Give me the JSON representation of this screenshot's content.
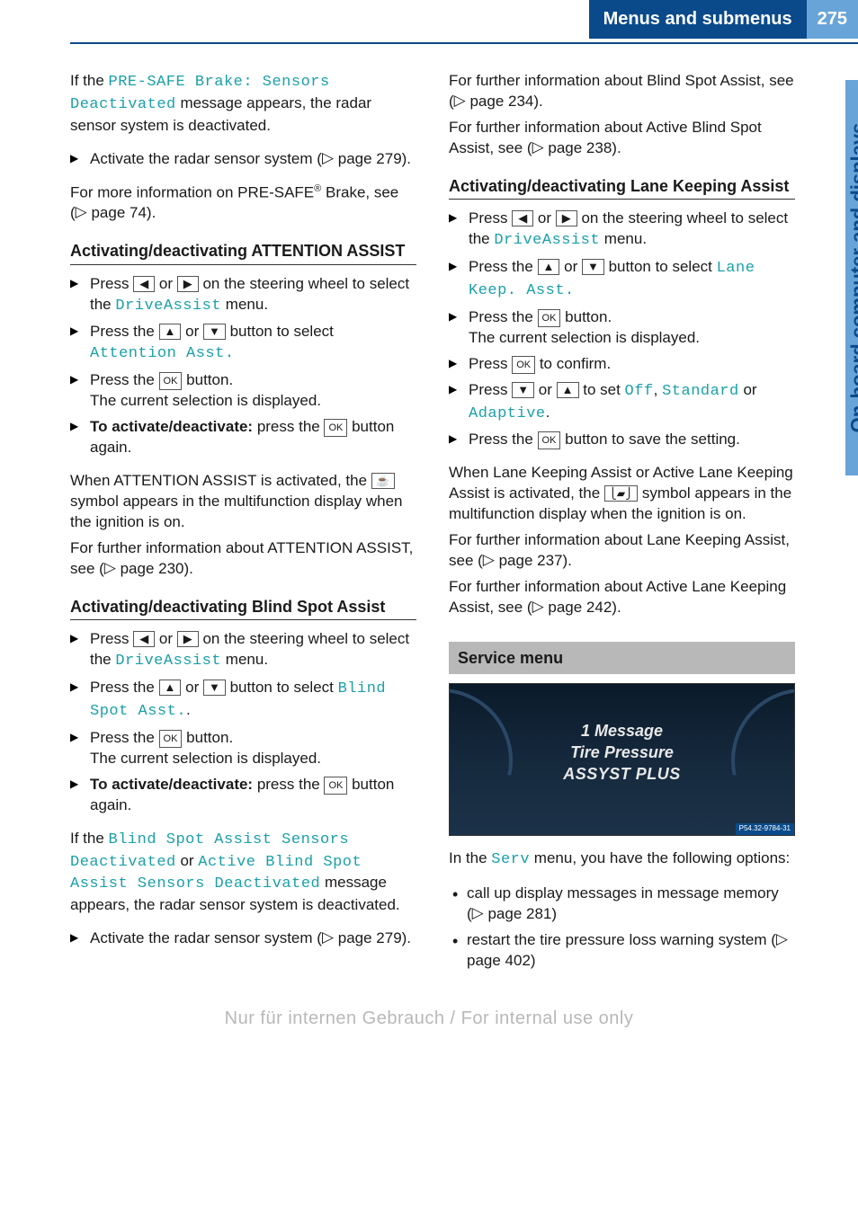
{
  "header": {
    "title": "Menus and submenus",
    "page": "275"
  },
  "thumb": {
    "label": "On-board computer and displays"
  },
  "icons": {
    "left": "◀",
    "right": "▶",
    "up": "▲",
    "down": "▼",
    "ok": "OK",
    "cup": "☕",
    "lane": "⎩▰⎭",
    "pageref": "▷"
  },
  "colA": {
    "p1_a": "If the ",
    "p1_teal": "PRE-SAFE Brake: Sensors Deactivated",
    "p1_b": " message appears, the radar sensor system is deactivated.",
    "s1_a": "Activate the radar sensor system (",
    "s1_b": " page 279).",
    "p2_a": "For more information on PRE-SAFE",
    "p2_sup": "®",
    "p2_b": " Brake, see (",
    "p2_c": " page 74).",
    "h1": "Activating/deactivating ATTENTION ASSIST",
    "a1_a": "Press ",
    "a1_b": " or ",
    "a1_c": " on the steering wheel to select the ",
    "a1_teal": "DriveAssist",
    "a1_d": " menu.",
    "a2_a": "Press the ",
    "a2_b": " or ",
    "a2_c": " button to select ",
    "a2_teal": "Attention Asst.",
    "a3_a": "Press the ",
    "a3_b": " button.",
    "a3_c": "The current selection is displayed.",
    "a4_a": "To activate/deactivate:",
    "a4_b": " press the ",
    "a4_c": " button again.",
    "p3_a": "When ATTENTION ASSIST is activated, the ",
    "p3_b": " symbol appears in the multifunction display when the ignition is on.",
    "p4_a": "For further information about ATTENTION ASSIST, see (",
    "p4_b": " page 230).",
    "h2": "Activating/deactivating Blind Spot Assist",
    "b1_a": "Press ",
    "b1_b": " or ",
    "b1_c": " on the steering wheel to select the ",
    "b1_teal": "DriveAssist",
    "b1_d": " menu.",
    "b2_a": "Press the ",
    "b2_b": " or ",
    "b2_c": " button to select ",
    "b2_teal": "Blind Spot Asst.",
    "b2_d": ".",
    "b3_a": "Press the ",
    "b3_b": " button.",
    "b3_c": "The current selection is displayed.",
    "b4_a": "To activate/deactivate:",
    "b4_b": " press the ",
    "b4_c": " button again.",
    "p5_a": "If the ",
    "p5_t1": "Blind Spot Assist Sensors Deactivated",
    "p5_b": " or ",
    "p5_t2": "Active Blind Spot Assist Sensors Deactivated",
    "p5_c": " message appears, the radar sensor system is deactivated.",
    "s2_a": "Activate the radar sensor system (",
    "s2_b": " page 279)."
  },
  "colB": {
    "p1_a": "For further information about Blind Spot Assist, see (",
    "p1_b": " page 234).",
    "p2_a": "For further information about Active Blind Spot Assist, see (",
    "p2_b": " page 238).",
    "h1": "Activating/deactivating Lane Keeping Assist",
    "l1_a": "Press ",
    "l1_b": " or ",
    "l1_c": " on the steering wheel to select the ",
    "l1_teal": "DriveAssist",
    "l1_d": " menu.",
    "l2_a": "Press the ",
    "l2_b": " or ",
    "l2_c": " button to select ",
    "l2_teal": "Lane Keep. Asst.",
    "l3_a": "Press the ",
    "l3_b": " button.",
    "l3_c": "The current selection is displayed.",
    "l4_a": "Press ",
    "l4_b": " to confirm.",
    "l5_a": "Press ",
    "l5_b": " or ",
    "l5_c": " to set ",
    "l5_t1": "Off",
    "l5_d": ", ",
    "l5_t2": "Standard",
    "l5_e": " or ",
    "l5_t3": "Adaptive",
    "l5_f": ".",
    "l6_a": "Press the ",
    "l6_b": " button to save the setting.",
    "p3_a": "When Lane Keeping Assist or Active Lane Keeping Assist is activated, the ",
    "p3_b": " symbol appears in the multifunction display when the ignition is on.",
    "p4_a": "For further information about Lane Keeping Assist, see (",
    "p4_b": " page 237).",
    "p5_a": "For further information about Active Lane Keeping Assist, see (",
    "p5_b": " page 242).",
    "section": "Service menu",
    "dash": {
      "l1": "1 Message",
      "l2": "Tire Pressure",
      "l3": "ASSYST PLUS",
      "code": "P54.32-9784-31"
    },
    "p6_a": "In the ",
    "p6_teal": "Serv",
    "p6_b": " menu, you have the following options:",
    "opt1_a": "call up display messages in message memory (",
    "opt1_b": " page 281)",
    "opt2_a": "restart the tire pressure loss warning system (",
    "opt2_b": " page 402)"
  },
  "watermark": "Nur für internen Gebrauch / For internal use only"
}
